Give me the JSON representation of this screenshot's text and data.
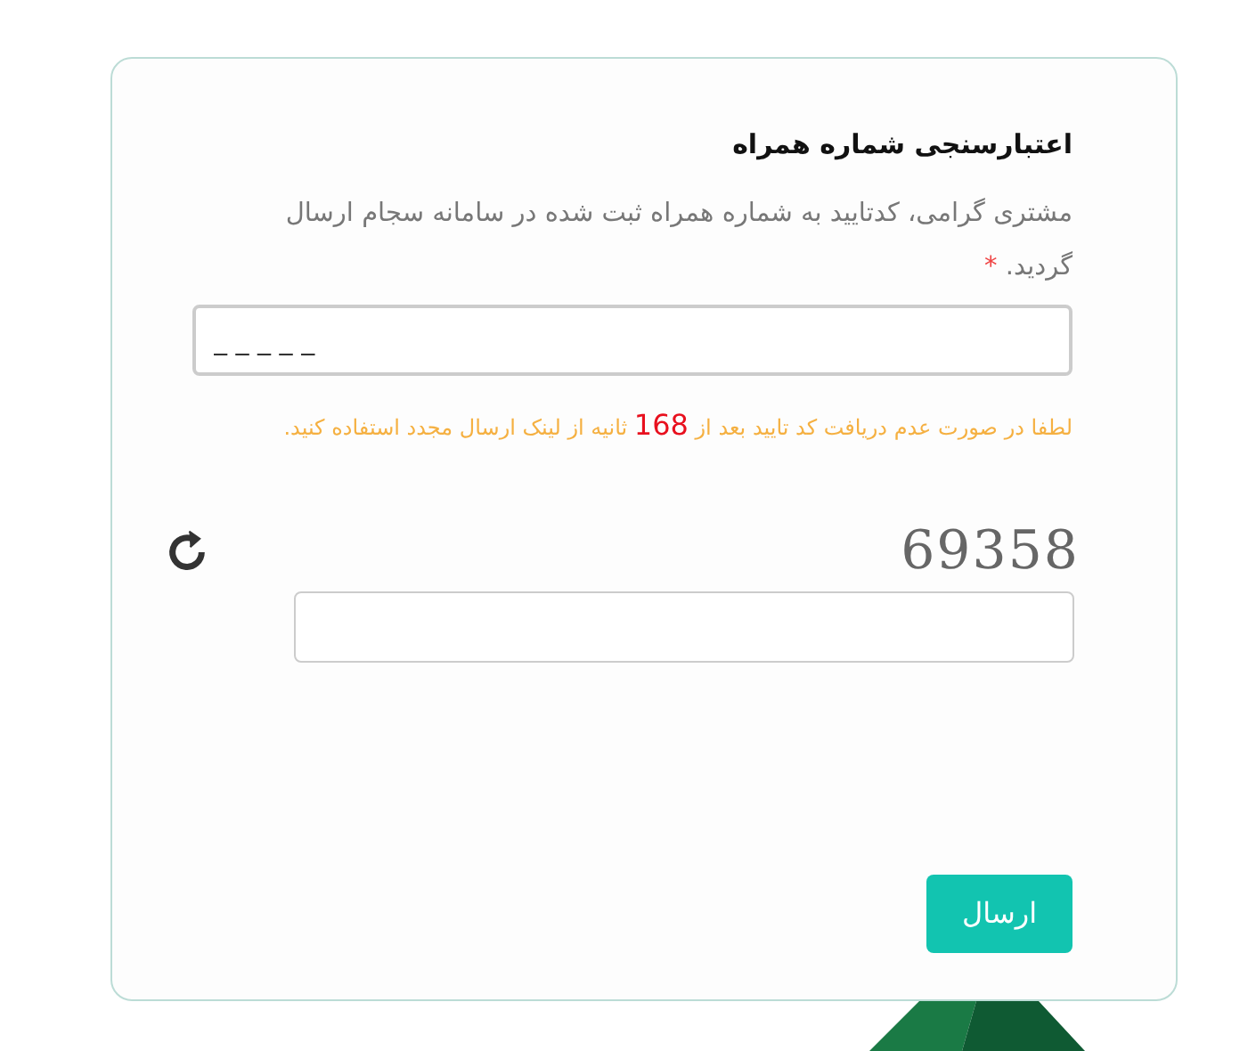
{
  "card": {
    "title": "اعتبارسنجی شماره همراه",
    "message": "مشتری گرامی، کدتایید به شماره همراه ثبت شده در سامانه سجام ارسال گردید.",
    "required_mark": "*",
    "code_field": {
      "placeholder": "_ _ _ _ _"
    },
    "timer": {
      "before": "لطفا در صورت عدم دریافت کد تایید بعد از",
      "count": "168",
      "after": "ثانیه از لینک ارسال مجدد استفاده کنید."
    },
    "captcha": {
      "text": "69358"
    },
    "submit": "ارسال"
  }
}
